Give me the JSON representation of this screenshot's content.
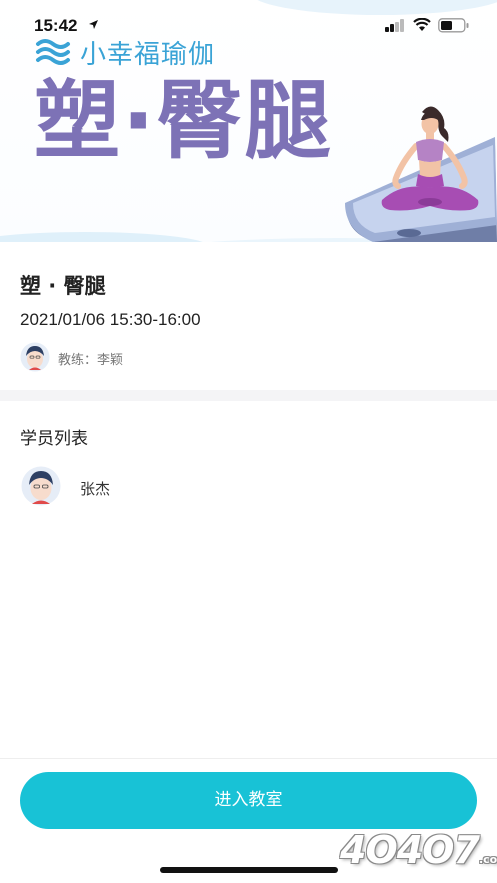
{
  "status_bar": {
    "time": "15:42"
  },
  "banner": {
    "logo_text": "小幸福瑜伽",
    "title": "塑·臀腿"
  },
  "class_info": {
    "title": "塑 · 臀腿",
    "time": "2021/01/06 15:30-16:00",
    "coach_label": "教练：李颖"
  },
  "students": {
    "heading": "学员列表",
    "items": [
      {
        "name": "张杰"
      }
    ]
  },
  "actions": {
    "enter_label": "进入教室"
  },
  "watermark": {
    "text": "4O4O7",
    "suffix": ".com"
  },
  "colors": {
    "accent": "#18c2d6",
    "banner_title": "#7d72b6",
    "logo": "#3aa3d6"
  }
}
